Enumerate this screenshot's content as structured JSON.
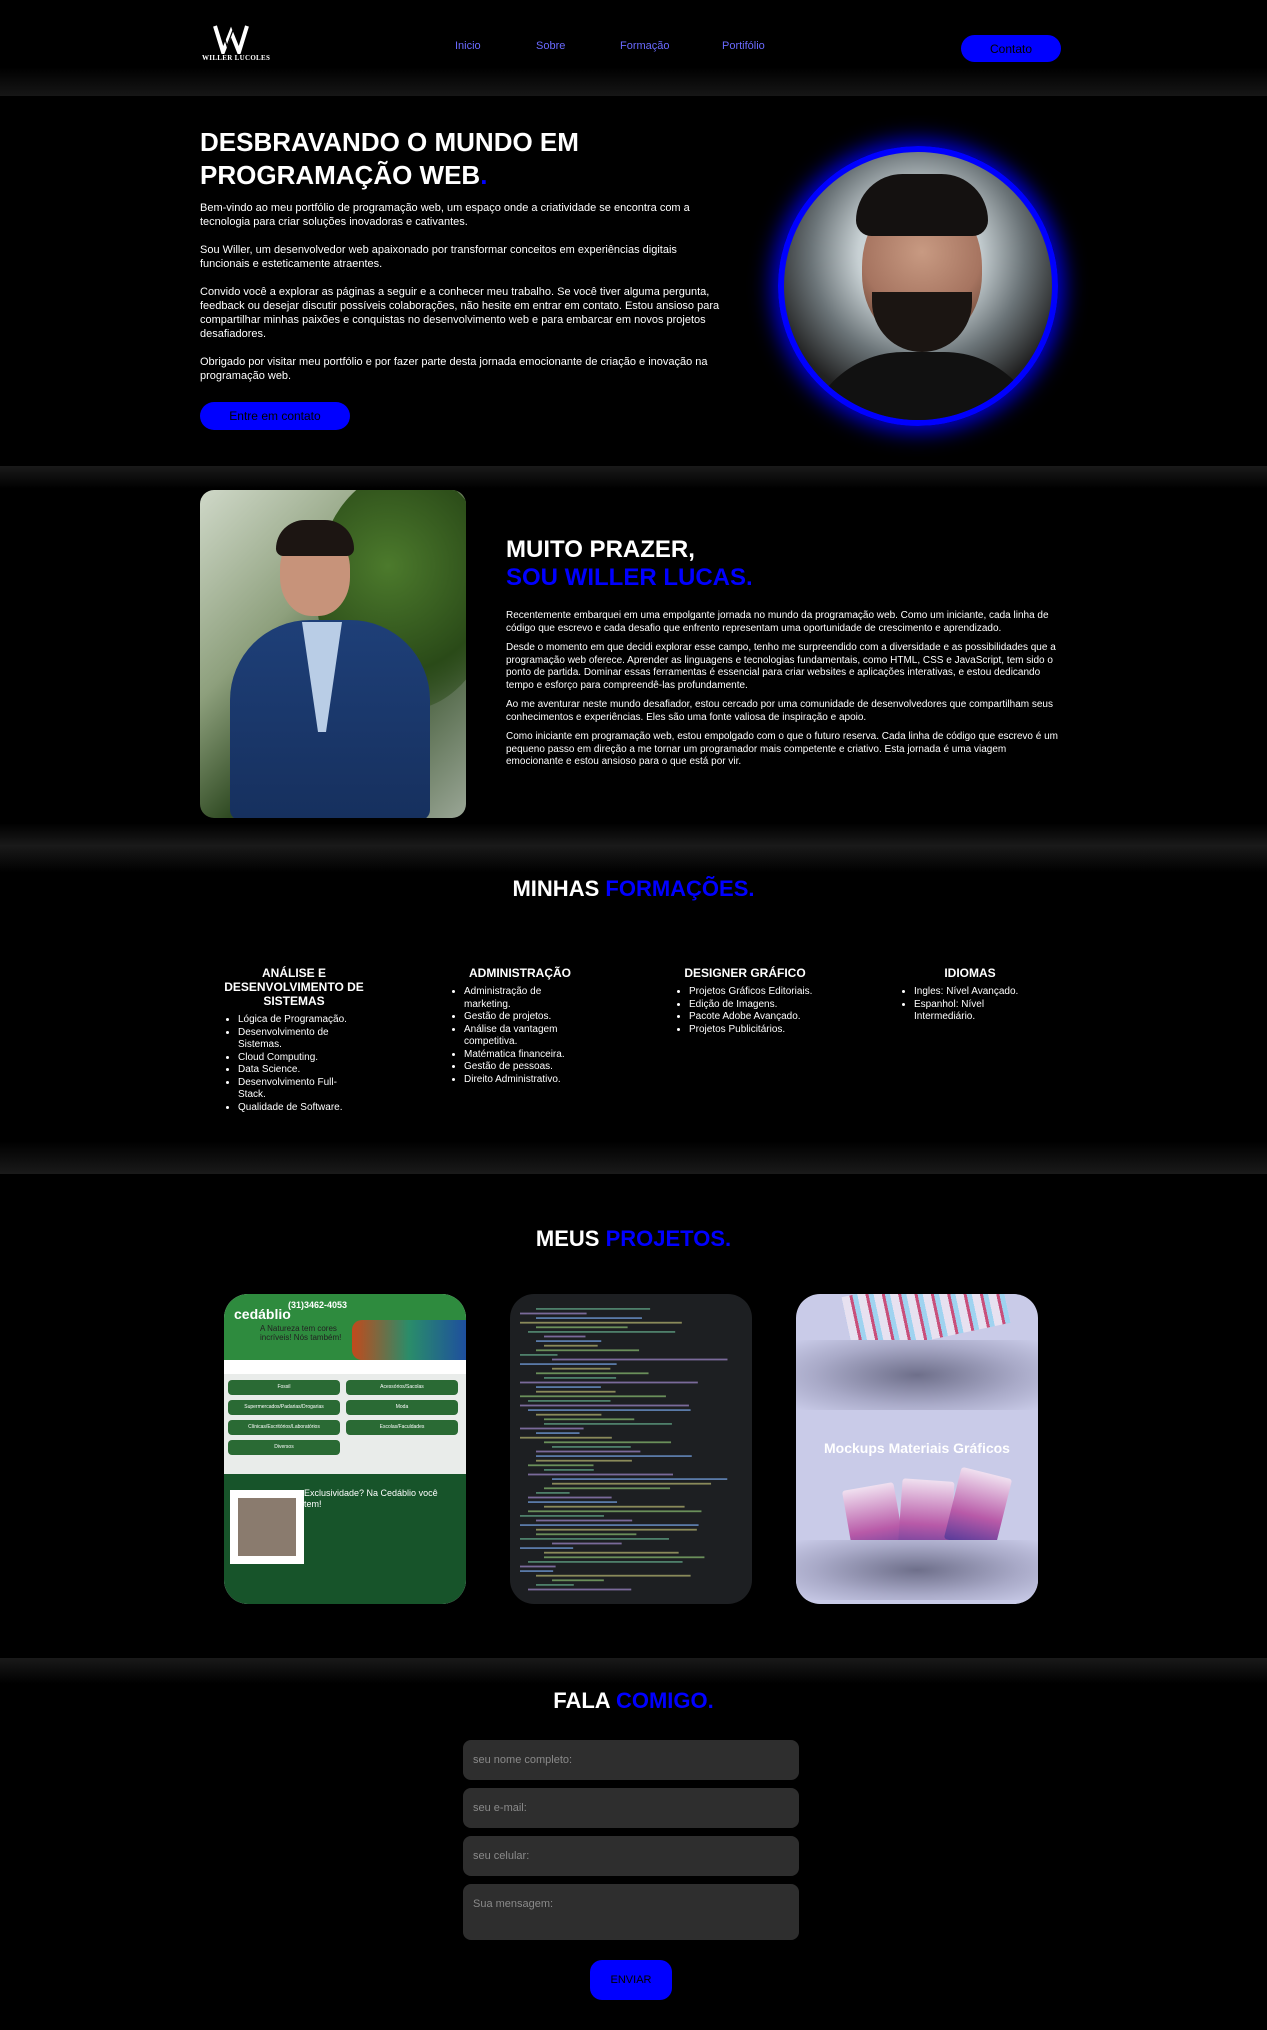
{
  "header": {
    "logo_text": "WILLER LUCOLES",
    "nav": [
      {
        "label": "Inicio"
      },
      {
        "label": "Sobre"
      },
      {
        "label": "Formação"
      },
      {
        "label": "Portifólio"
      }
    ],
    "contact_button": "Contato"
  },
  "hero": {
    "title_line1": "DESBRAVANDO O MUNDO EM",
    "title_line2": "PROGRAMAÇÃO WEB",
    "title_dot": ".",
    "paragraphs": [
      "Bem-vindo ao meu portfólio de programação web, um espaço onde a criatividade se encontra com a tecnologia para criar soluções inovadoras e cativantes.",
      "Sou Willer, um desenvolvedor web apaixonado por transformar conceitos em experiências digitais funcionais e esteticamente atraentes.",
      "Convido você a explorar as páginas a seguir e a conhecer meu trabalho. Se você tiver alguma pergunta, feedback ou desejar discutir possíveis colaborações, não hesite em entrar em contato. Estou ansioso para compartilhar minhas paixões e conquistas no desenvolvimento web e para embarcar em novos projetos desafiadores.",
      "Obrigado por visitar meu portfólio e por fazer parte desta jornada emocionante de criação e inovação na programação web."
    ],
    "button": "Entre em contato"
  },
  "about": {
    "title_line1": "MUITO PRAZER,",
    "title_line2": "SOU WILLER LUCAS.",
    "paragraphs": [
      "Recentemente embarquei em uma empolgante jornada no mundo da programação web. Como um iniciante, cada linha de código que escrevo e cada desafio que enfrento representam uma oportunidade de crescimento e aprendizado.",
      "Desde o momento em que decidi explorar esse campo, tenho me surpreendido com a diversidade e as possibilidades que a programação web oferece. Aprender as linguagens e tecnologias fundamentais, como HTML, CSS e JavaScript, tem sido o ponto de partida. Dominar essas ferramentas é essencial para criar websites e aplicações interativas, e estou dedicando tempo e esforço para compreendê-las profundamente.",
      "Ao me aventurar neste mundo desafiador, estou cercado por uma comunidade de desenvolvedores que compartilham seus conhecimentos e experiências. Eles são uma fonte valiosa de inspiração e apoio.",
      "Como iniciante em programação web, estou empolgado com o que o futuro reserva. Cada linha de código que escrevo é um pequeno passo em direção a me tornar um programador mais competente e criativo. Esta jornada é uma viagem emocionante e estou ansioso para o que está por vir."
    ]
  },
  "formacoes": {
    "title_a": "MINHAS",
    "title_b": "FORMAÇÕES.",
    "columns": [
      {
        "title": "ANÁLISE E DESENVOLVIMENTO DE SISTEMAS",
        "items": [
          "Lógica de Programação.",
          "Desenvolvimento de Sistemas.",
          "Cloud Computing.",
          "Data Science.",
          "Desenvolvimento Full-Stack.",
          "Qualidade de Software."
        ]
      },
      {
        "title": "ADMINISTRAÇÃO",
        "items": [
          "Administração de marketing.",
          "Gestão de projetos.",
          "Análise da vantagem competitiva.",
          "Matématica financeira.",
          "Gestão de pessoas.",
          "Direito Administrativo."
        ]
      },
      {
        "title": "DESIGNER GRÁFICO",
        "items": [
          "Projetos Gráficos Editoriais.",
          "Edição de Imagens.",
          "Pacote Adobe Avançado.",
          "Projetos Publicitários."
        ]
      },
      {
        "title": "IDIOMAS",
        "items": [
          "Ingles: Nível Avançado.",
          "Espanhol: Nível Intermediário."
        ]
      }
    ]
  },
  "projetos": {
    "title_a": "MEUS",
    "title_b": "PROJETOS.",
    "card1": {
      "brand": "cedáblio",
      "phone": "(31)3462-4053",
      "tagline": "A Natureza tem cores incríveis! Nós também!",
      "pills": [
        "Fossil",
        "Acessórios/Sacolas",
        "Supermercados/Padarias/Drogarias",
        "Moda",
        "Clínicas/Escritórios/Laboratórios",
        "Escolas/Faculdades",
        "Diversos"
      ],
      "exclusive": "Exclusividade? Na Cedáblio você tem!"
    },
    "card3": {
      "label": "Mockups Materiais Gráficos"
    }
  },
  "contato": {
    "title_a": "FALA",
    "title_b": "COMIGO.",
    "name_placeholder": "seu nome completo:",
    "email_placeholder": "seu e-mail:",
    "phone_placeholder": "seu celular:",
    "message_placeholder": "Sua mensagem:",
    "send": "ENVIAR"
  },
  "colors": {
    "accent": "#0000ff",
    "background": "#000000",
    "nav_link": "#6a6aff",
    "field_bg": "#2e2e2e"
  }
}
